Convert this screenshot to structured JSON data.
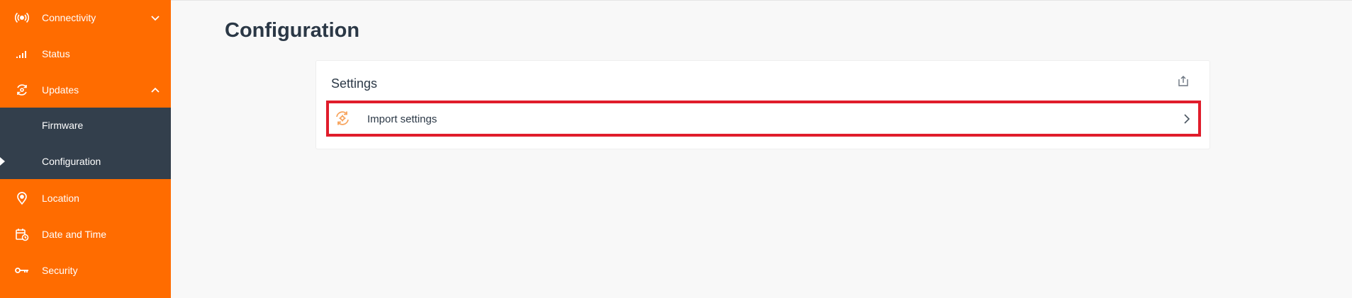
{
  "sidebar": {
    "items": [
      {
        "label": "Connectivity",
        "icon": "antenna-icon"
      },
      {
        "label": "Status",
        "icon": "signal-bars-icon"
      },
      {
        "label": "Updates",
        "icon": "update-sync-icon"
      },
      {
        "label": "Location",
        "icon": "location-pin-icon"
      },
      {
        "label": "Date and Time",
        "icon": "calendar-clock-icon"
      },
      {
        "label": "Security",
        "icon": "key-icon"
      }
    ],
    "submenu": [
      {
        "label": "Firmware"
      },
      {
        "label": "Configuration",
        "active": true
      }
    ]
  },
  "main": {
    "title": "Configuration",
    "card": {
      "title": "Settings",
      "rows": [
        {
          "label": "Import settings",
          "icon": "import-settings-icon"
        }
      ]
    }
  },
  "colors": {
    "sidebar_bg": "#ff6c00",
    "submenu_bg": "#333f4c",
    "highlight_border": "#e01d2b",
    "text_dark": "#2b3846",
    "accent_icon": "#f7a35c"
  }
}
